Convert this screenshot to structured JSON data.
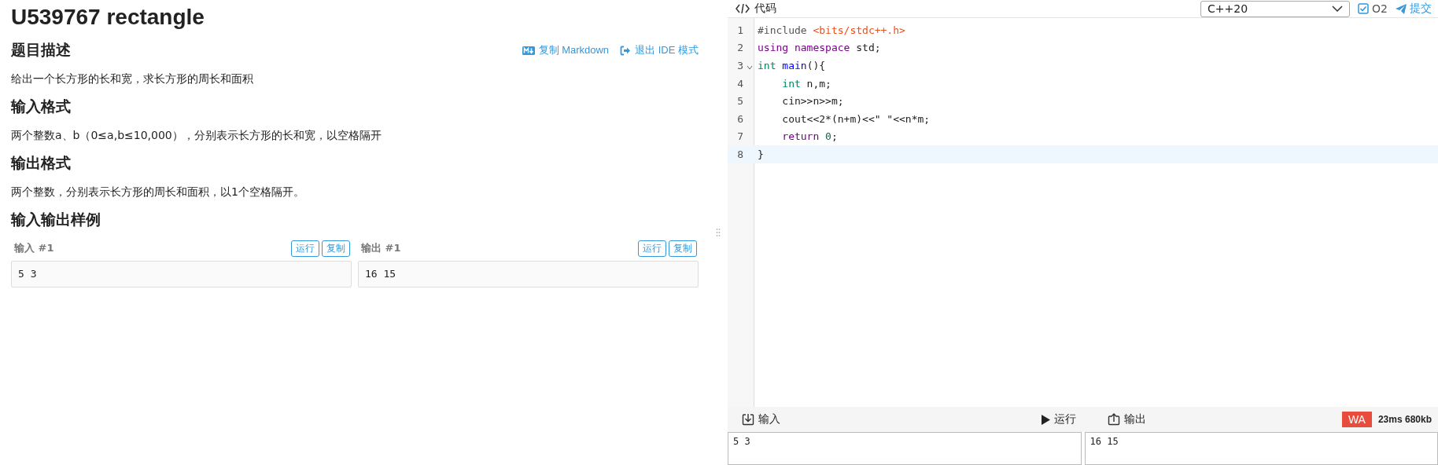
{
  "problem": {
    "title": "U539767 rectangle",
    "actions": [
      {
        "kind": "markdown",
        "label": "复制 Markdown"
      },
      {
        "kind": "exit",
        "label": "退出 IDE 模式"
      }
    ],
    "sections": [
      {
        "heading": "题目描述",
        "text": "给出一个长方形的长和宽，求长方形的周长和面积"
      },
      {
        "heading": "输入格式",
        "text": "两个整数a、b（0≤a,b≤10,000），分别表示长方形的长和宽，以空格隔开"
      },
      {
        "heading": "输出格式",
        "text": "两个整数，分别表示长方形的周长和面积，以1个空格隔开。"
      }
    ],
    "samples_heading": "输入输出样例",
    "samples": [
      {
        "label": "输入 #1",
        "buttons": [
          "运行",
          "复制"
        ],
        "value": "5 3"
      },
      {
        "label": "输出 #1",
        "buttons": [
          "运行",
          "复制"
        ],
        "value": "16 15"
      }
    ]
  },
  "editor": {
    "header": {
      "title": "代码",
      "language": "C++20",
      "o2": {
        "label": "O2",
        "checked": true
      },
      "submit": "提交"
    },
    "lines": [
      {
        "number": "1",
        "selected": false,
        "foldable": false,
        "tokens": [
          {
            "kind": "meta",
            "text": "#include "
          },
          {
            "kind": "string",
            "text": "<bits/stdc++.h>"
          }
        ]
      },
      {
        "number": "2",
        "selected": false,
        "foldable": false,
        "tokens": [
          {
            "kind": "keyword",
            "text": "using"
          },
          {
            "kind": "keyword",
            "text": " namespace"
          },
          {
            "kind": "plain",
            "text": " std;"
          }
        ]
      },
      {
        "number": "3",
        "selected": false,
        "foldable": true,
        "tokens": [
          {
            "kind": "type",
            "text": "int"
          },
          {
            "kind": "def",
            "text": " main"
          },
          {
            "kind": "plain",
            "text": "(){"
          }
        ]
      },
      {
        "number": "4",
        "selected": false,
        "foldable": false,
        "tokens": [
          {
            "kind": "type",
            "text": "    int"
          },
          {
            "kind": "plain",
            "text": " n,m;"
          }
        ]
      },
      {
        "number": "5",
        "selected": false,
        "foldable": false,
        "tokens": [
          {
            "kind": "plain",
            "text": "    cin>>n>>m;"
          }
        ]
      },
      {
        "number": "6",
        "selected": false,
        "foldable": false,
        "tokens": [
          {
            "kind": "plain",
            "text": "    cout<<2*(n+m)<<\" \"<<n*m;"
          }
        ]
      },
      {
        "number": "7",
        "selected": false,
        "foldable": false,
        "tokens": [
          {
            "kind": "keyword",
            "text": "    return"
          },
          {
            "kind": "number",
            "text": " 0"
          },
          {
            "kind": "plain",
            "text": ";"
          }
        ]
      },
      {
        "number": "8",
        "selected": true,
        "foldable": false,
        "tokens": [
          {
            "kind": "plain",
            "text": "}"
          }
        ]
      }
    ]
  },
  "runner": {
    "input_label": "输入",
    "run_label": "运行",
    "output_label": "输出",
    "verdict": "WA",
    "stats": "23ms 680kb",
    "input_value": "5 3",
    "output_value": "16 15"
  }
}
